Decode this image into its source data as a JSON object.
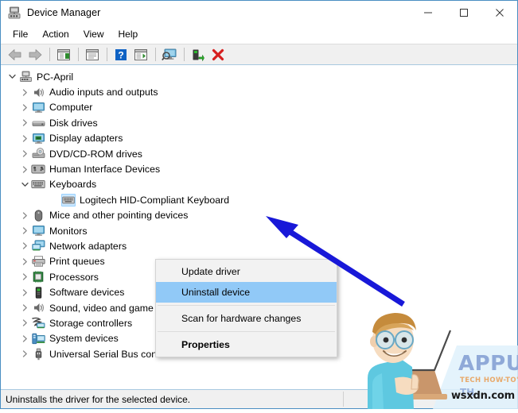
{
  "window": {
    "title": "Device Manager",
    "icon": "device-manager-icon",
    "controls": {
      "minimize": "─",
      "maximize": "☐",
      "close": "✕"
    }
  },
  "menubar": {
    "items": [
      {
        "label": "File"
      },
      {
        "label": "Action"
      },
      {
        "label": "View"
      },
      {
        "label": "Help"
      }
    ]
  },
  "toolbar": {
    "buttons": [
      {
        "name": "back-arrow-icon",
        "tip": "Back"
      },
      {
        "name": "forward-arrow-icon",
        "tip": "Forward"
      },
      {
        "name": "show-hide-console-tree-icon",
        "tip": "Show/Hide Console Tree"
      },
      {
        "name": "properties-panel-icon",
        "tip": "Properties"
      },
      {
        "name": "help-icon",
        "tip": "Help"
      },
      {
        "name": "show-action-pane-icon",
        "tip": "Show/Hide Action Pane"
      },
      {
        "name": "scan-for-hardware-changes-icon",
        "tip": "Scan for hardware changes"
      },
      {
        "name": "update-driver-icon",
        "tip": "Update driver"
      },
      {
        "name": "uninstall-device-icon",
        "tip": "Uninstall device"
      }
    ]
  },
  "tree": {
    "nodes": [
      {
        "label": "PC-April",
        "level": 0,
        "state": "expanded",
        "icon": "computer-root-icon",
        "selected": false
      },
      {
        "label": "Audio inputs and outputs",
        "level": 1,
        "state": "collapsed",
        "icon": "speaker-icon",
        "selected": false
      },
      {
        "label": "Computer",
        "level": 1,
        "state": "collapsed",
        "icon": "monitor-icon",
        "selected": false
      },
      {
        "label": "Disk drives",
        "level": 1,
        "state": "collapsed",
        "icon": "disk-drive-icon",
        "selected": false
      },
      {
        "label": "Display adapters",
        "level": 1,
        "state": "collapsed",
        "icon": "display-adapter-icon",
        "selected": false
      },
      {
        "label": "DVD/CD-ROM drives",
        "level": 1,
        "state": "collapsed",
        "icon": "dvd-drive-icon",
        "selected": false
      },
      {
        "label": "Human Interface Devices",
        "level": 1,
        "state": "collapsed",
        "icon": "hid-icon",
        "selected": false
      },
      {
        "label": "Keyboards",
        "level": 1,
        "state": "expanded",
        "icon": "keyboard-icon",
        "selected": false
      },
      {
        "label": "Logitech HID-Compliant Keyboard",
        "level": 2,
        "state": "leaf",
        "icon": "keyboard-icon",
        "selected": true
      },
      {
        "label": "Mice and other pointing devices",
        "level": 1,
        "state": "collapsed",
        "icon": "mouse-icon",
        "selected": false
      },
      {
        "label": "Monitors",
        "level": 1,
        "state": "collapsed",
        "icon": "monitor-icon",
        "selected": false
      },
      {
        "label": "Network adapters",
        "level": 1,
        "state": "collapsed",
        "icon": "network-adapter-icon",
        "selected": false
      },
      {
        "label": "Print queues",
        "level": 1,
        "state": "collapsed",
        "icon": "printer-icon",
        "selected": false
      },
      {
        "label": "Processors",
        "level": 1,
        "state": "collapsed",
        "icon": "processor-icon",
        "selected": false
      },
      {
        "label": "Software devices",
        "level": 1,
        "state": "collapsed",
        "icon": "software-device-icon",
        "selected": false
      },
      {
        "label": "Sound, video and game controllers",
        "level": 1,
        "state": "collapsed",
        "icon": "speaker-icon",
        "selected": false
      },
      {
        "label": "Storage controllers",
        "level": 1,
        "state": "collapsed",
        "icon": "storage-controller-icon",
        "selected": false
      },
      {
        "label": "System devices",
        "level": 1,
        "state": "collapsed",
        "icon": "system-device-icon",
        "selected": false
      },
      {
        "label": "Universal Serial Bus controllers",
        "level": 1,
        "state": "collapsed",
        "icon": "usb-icon",
        "selected": false
      }
    ]
  },
  "context_menu": {
    "items": [
      {
        "label": "Update driver",
        "highlighted": false,
        "bold": false
      },
      {
        "label": "Uninstall device",
        "highlighted": true,
        "bold": false
      },
      {
        "label": "Scan for hardware changes",
        "highlighted": false,
        "bold": false
      },
      {
        "label": "Properties",
        "highlighted": false,
        "bold": true
      }
    ]
  },
  "statusbar": {
    "text": "Uninstalls the driver for the selected device."
  },
  "annotation": {
    "arrow_color": "#1818d8",
    "points_to": "Uninstall device"
  },
  "watermark": {
    "brand": "APPUALS",
    "tagline": "TECH HOW-TO'S FROM",
    "url": "wsxdn.com"
  },
  "colors": {
    "window_border": "#4a8ec2",
    "toolbar_bg": "#f0f0f0",
    "menu_highlight": "#91c9f7",
    "tree_selected_icon": "#cce8ff",
    "arrow": "#1818d8",
    "brand": "#8fa9d8"
  }
}
